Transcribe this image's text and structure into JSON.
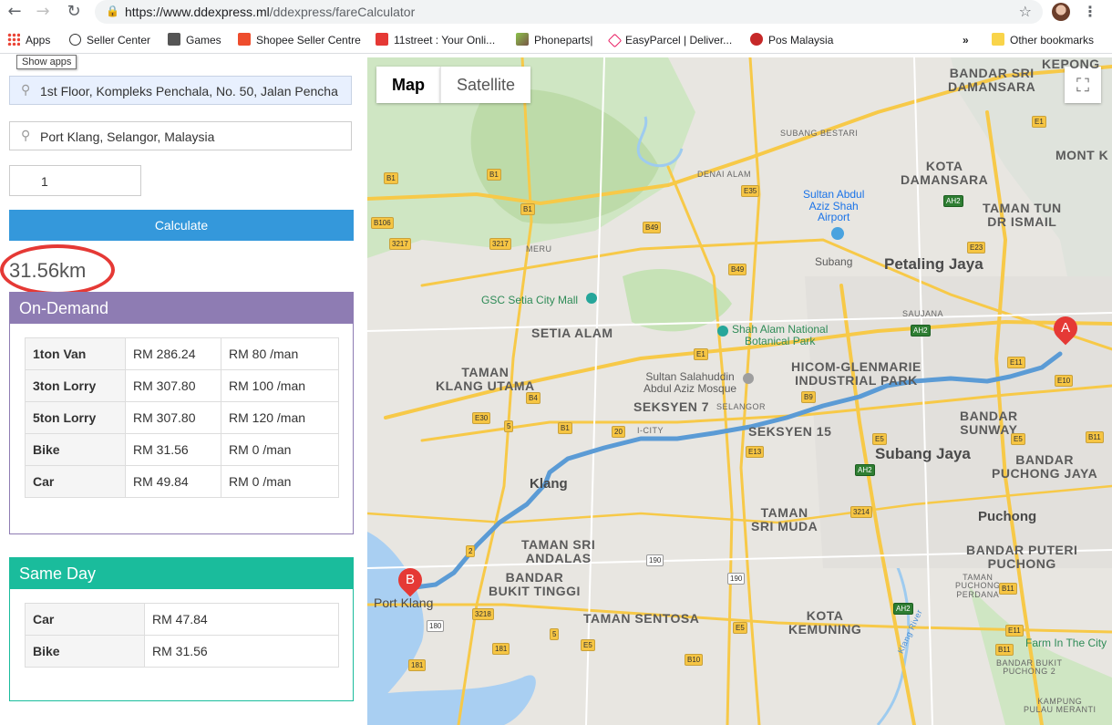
{
  "browser": {
    "url_host": "https://www.ddexpress.ml",
    "url_path": "/ddexpress/fareCalculator",
    "bookmarks": [
      "Apps",
      "Seller Center",
      "Games",
      "Shopee Seller Centre",
      "11street : Your Onli...",
      "Phoneparts|",
      "EasyParcel | Deliver...",
      "Pos Malaysia",
      "Other bookmarks"
    ],
    "tooltip": "Show apps"
  },
  "form": {
    "origin": "1st Floor, Kompleks Penchala, No. 50, Jalan Pencha",
    "destination": "Port Klang, Selangor, Malaysia",
    "quantity": "1",
    "calculate_label": "Calculate"
  },
  "result": {
    "distance": "31.56km"
  },
  "on_demand": {
    "title": "On-Demand",
    "color": "#8e7cb3",
    "rows": [
      {
        "vehicle": "1ton Van",
        "price": "RM 286.24",
        "man": "RM 80 /man"
      },
      {
        "vehicle": "3ton Lorry",
        "price": "RM 307.80",
        "man": "RM 100 /man"
      },
      {
        "vehicle": "5ton Lorry",
        "price": "RM 307.80",
        "man": "RM 120 /man"
      },
      {
        "vehicle": "Bike",
        "price": "RM 31.56",
        "man": "RM 0 /man"
      },
      {
        "vehicle": "Car",
        "price": "RM 49.84",
        "man": "RM 0 /man"
      }
    ]
  },
  "same_day": {
    "title": "Same Day",
    "color": "#1abc9c",
    "rows": [
      {
        "vehicle": "Car",
        "price": "RM 47.84"
      },
      {
        "vehicle": "Bike",
        "price": "RM 31.56"
      }
    ]
  },
  "map": {
    "type_map": "Map",
    "type_satellite": "Satellite",
    "marker_a": "A",
    "marker_b": "B",
    "places": {
      "bandar_sri_damansara": "BANDAR SRI\nDAMANSARA",
      "kepong": "KEPONG",
      "mont_kiara": "MONT K",
      "kota_damansara": "KOTA\nDAMANSARA",
      "taman_tun": "TAMAN TUN\nDR ISMAIL",
      "subang_bestari": "SUBANG BESTARI",
      "denai_alam": "DENAI ALAM",
      "airport": "Sultan Abdul\nAziz Shah\nAirport",
      "subang": "Subang",
      "petaling_jaya": "Petaling Jaya",
      "meru": "MERU",
      "gsc": "GSC Setia City Mall",
      "setia_alam": "SETIA ALAM",
      "saujana": "SAUJANA",
      "botanical": "Shah Alam National\nBotanical Park",
      "taman_klang_utama": "TAMAN\nKLANG UTAMA",
      "mosque": "Sultan Salahuddin\nAbdul Aziz Mosque",
      "hicom": "HICOM-GLENMARIE\nINDUSTRIAL PARK",
      "seksyen7": "SEKSYEN 7",
      "selangor": "SELANGOR",
      "icity": "I-CITY",
      "seksyen15": "SEKSYEN 15",
      "bandar_sunway": "BANDAR\nSUNWAY",
      "subang_jaya": "Subang Jaya",
      "bandar_puchong_jaya": "BANDAR\nPUCHONG JAYA",
      "klang": "Klang",
      "taman_sri_muda": "TAMAN\nSRI MUDA",
      "puchong": "Puchong",
      "taman_sri_andalas": "TAMAN SRI\nANDALAS",
      "bandar_puteri": "BANDAR PUTERI\nPUCHONG",
      "bandar_bukit_tinggi": "BANDAR\nBUKIT TINGGI",
      "port_klang": "Port Klang",
      "taman_puchong_perdana": "TAMAN\nPUCHONG\nPERDANA",
      "taman_sentosa": "TAMAN SENTOSA",
      "kota_kemuning": "KOTA\nKEMUNING",
      "klang_river": "Klang River",
      "farm": "Farm In The City",
      "bandar_bukit_puchong": "BANDAR BUKIT\nPUCHONG 2",
      "kampung_pulau_meranti": "KAMPUNG\nPULAU MERANTI"
    }
  }
}
